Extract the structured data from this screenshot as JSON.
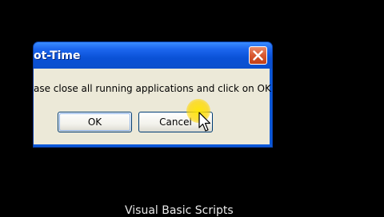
{
  "dialog": {
    "title": "ot-Time",
    "message": "ase close all running applications and click on OK.",
    "ok_label": "OK",
    "cancel_label": "Cancel",
    "close_icon": "close-x-icon"
  },
  "caption": "Visual Basic Scripts",
  "colors": {
    "background": "#000000",
    "titlebar": "#0b58d8",
    "client": "#ece9d8",
    "close_button": "#d9582f",
    "highlight": "#ffd700"
  },
  "cursor_icon": "arrow-cursor-icon"
}
